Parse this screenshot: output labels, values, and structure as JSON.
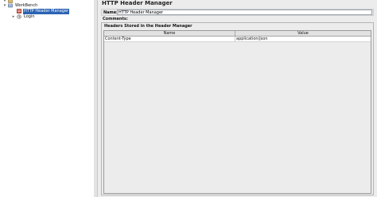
{
  "tree": {
    "nodes": [
      {
        "label": "",
        "icon": "test-plan-icon",
        "toggle": "▾"
      },
      {
        "label": "WorkBench",
        "icon": "workbench-icon",
        "toggle": "▾"
      },
      {
        "label": "HTTP Header Manager",
        "icon": "header-manager-icon",
        "toggle": "",
        "selected": true
      },
      {
        "label": "Login",
        "icon": "thread-group-icon",
        "toggle": "▸"
      }
    ]
  },
  "editor": {
    "title": "HTTP Header Manager",
    "name_label": "Name:",
    "name_value": "HTTP Header Manager",
    "comments_label": "Comments:",
    "group_title": "Headers Stored in the Header Manager",
    "table": {
      "columns": [
        "Name",
        "Value"
      ],
      "rows": [
        {
          "name": "Content-Type",
          "value": "application/json"
        }
      ]
    }
  },
  "colors": {
    "selection": "#2b63b4",
    "panel_bg": "#ececec",
    "tree_bg": "#ffffff"
  }
}
